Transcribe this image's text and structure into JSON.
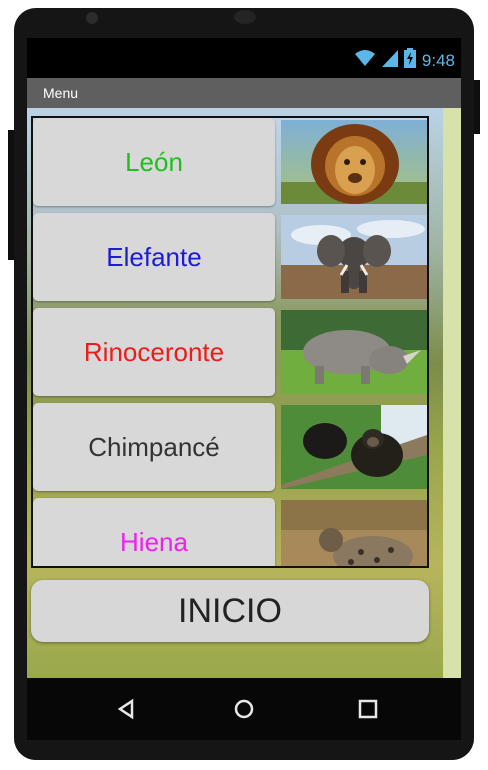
{
  "status_bar": {
    "time": "9:48",
    "icons": [
      "wifi-icon",
      "signal-icon",
      "battery-charging-icon"
    ],
    "icon_color": "#5ab7e8"
  },
  "title_bar": {
    "title": "Menu"
  },
  "animals": [
    {
      "label": "León",
      "color": "#1fbf1f",
      "image": "lion-photo"
    },
    {
      "label": "Elefante",
      "color": "#1c1cd6",
      "image": "elephant-photo"
    },
    {
      "label": "Rinoceronte",
      "color": "#ee1b1b",
      "image": "rhino-photo"
    },
    {
      "label": "Chimpancé",
      "color": "#333333",
      "image": "chimpanzee-photo"
    },
    {
      "label": "Hiena",
      "color": "#ee22ee",
      "image": "hyena-photo"
    }
  ],
  "inicio_button": {
    "label": "INICIO"
  },
  "nav_bar": {
    "items": [
      "back-icon",
      "home-icon",
      "recents-icon"
    ]
  }
}
